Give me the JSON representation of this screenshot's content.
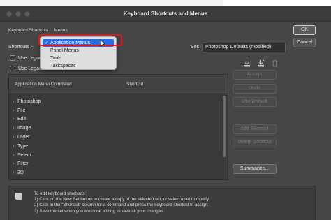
{
  "window": {
    "title": "Keyboard Shortcuts and Menus"
  },
  "breadcrumb": {
    "shortcuts": "Keyboard Shortcuts",
    "menus": "Menus"
  },
  "shortcuts_for": {
    "label": "Shortcuts F"
  },
  "set": {
    "label": "Set:",
    "value": "Photoshop Defaults (modified)"
  },
  "checkboxes": [
    {
      "label": "Use Legac",
      "checked": false
    },
    {
      "label": "Use Legac",
      "checked": false
    }
  ],
  "dropdown": {
    "items": [
      {
        "label": "Application Menus",
        "selected": true
      },
      {
        "label": "Panel Menus",
        "selected": false
      },
      {
        "label": "Tools",
        "selected": false
      },
      {
        "label": "Taskspaces",
        "selected": false
      }
    ],
    "check_glyph": "✓"
  },
  "toolbar_icons": [
    "save-set-icon",
    "save-set-as-icon",
    "delete-set-icon"
  ],
  "table": {
    "headers": {
      "command": "Application Menu Command",
      "shortcut": "Shortcut"
    },
    "rows": [
      "Photoshop",
      "File",
      "Edit",
      "Image",
      "Layer",
      "Type",
      "Select",
      "Filter",
      "3D"
    ]
  },
  "buttons": {
    "ok": "OK",
    "cancel": "Cancel",
    "accept": "Accept",
    "undo": "Undo",
    "use_default": "Use Default",
    "add_shortcut": "Add Shortcut",
    "delete_shortcut": "Delete Shortcut",
    "summarize": "Summarize..."
  },
  "info": {
    "lines": [
      "To edit keyboard shortcuts:",
      "1) Click on the New Set button to create a copy of the selected set, or select a set to modify.",
      "2) Click in the \"Shortcut\" column for a command and press the keyboard shortcut to assign.",
      "3) Save the set when you are done editing to save all your changes."
    ]
  },
  "colors": {
    "accent": "#2d6be0",
    "highlight": "#e8161c",
    "dialog_bg": "#464646"
  }
}
